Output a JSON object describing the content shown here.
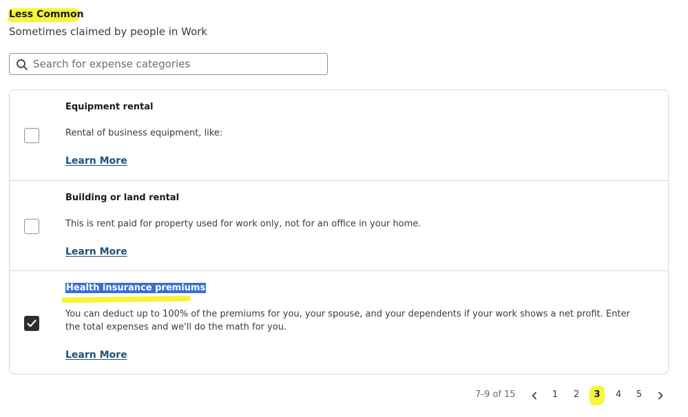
{
  "section": {
    "title": "Less Common",
    "subtitle": "Sometimes claimed by people in Work"
  },
  "search": {
    "placeholder": "Search for expense categories",
    "value": "",
    "icon": "search-icon"
  },
  "items": [
    {
      "title": "Equipment rental",
      "description": "Rental of business equipment, like:",
      "link": "Learn More",
      "checked": false
    },
    {
      "title": "Building or land rental",
      "description": "This is rent paid for property used for work only, not for an office in your home.",
      "link": "Learn More",
      "checked": false
    },
    {
      "title": "Health insurance premiums",
      "description": "You can deduct up to 100% of the premiums for you, your spouse, and your dependents if your work shows a net profit. Enter the total expenses and we'll do the math for you.",
      "link": "Learn More",
      "checked": true
    }
  ],
  "pagination": {
    "range": "7-9 of 15",
    "pages": [
      "1",
      "2",
      "3",
      "4",
      "5"
    ],
    "current": "3",
    "prev_icon": "chevron-left-icon",
    "next_icon": "chevron-right-icon"
  },
  "colors": {
    "highlight": "#f5f53a",
    "selection": "#3a6fd0",
    "link": "#1e5078",
    "checkbox_checked": "#2d2e33",
    "border": "#d4d7dc"
  }
}
